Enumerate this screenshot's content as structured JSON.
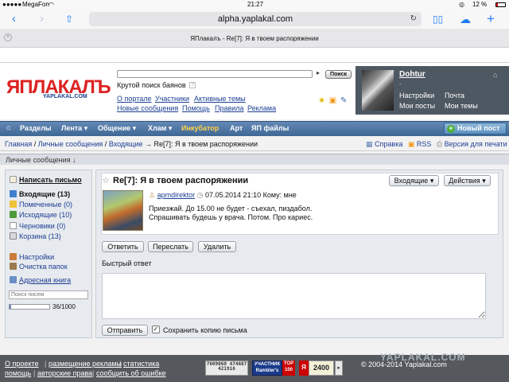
{
  "status": {
    "carrier": "MegaFon",
    "time": "21:27",
    "battery": "12 %"
  },
  "browser": {
    "url": "alpha.yaplakal.com",
    "tab_title": "ЯПлакалъ - Re[7]: Я в твоем распоряжении"
  },
  "header": {
    "logo_main": "ЯПЛАКАЛЪ",
    "logo_sub": "YAPLAKAL.COM",
    "search_placeholder": "",
    "search_button": "Поиск",
    "tagline": "Крутой поиск баянов",
    "links_row1": [
      "О портале",
      "Участники",
      "Активные темы"
    ],
    "links_row2": [
      "Новые сообщения",
      "Помощь",
      "Правила",
      "Реклама"
    ]
  },
  "user": {
    "name": "Dohtur",
    "dash": "-",
    "links": [
      "Настройки",
      "Почта",
      "Мои посты",
      "Мои темы"
    ]
  },
  "nav": {
    "items": [
      "Разделы",
      "Лента",
      "Общение",
      "Хлам",
      "Инкубатор",
      "Арт",
      "ЯП файлы"
    ],
    "new_post": "Новый пост",
    "highlight_color": "#ffd24a"
  },
  "breadcrumb": {
    "items": [
      "Главная",
      "Личные сообщения",
      "Входящие"
    ],
    "current": "Re[7]: Я в твоем распоряжении",
    "right": [
      "Справка",
      "RSS",
      "Версия для печати"
    ]
  },
  "section_title": "Личные сообщения ↓",
  "sidebar": {
    "write": "Написать письмо",
    "folders": [
      {
        "label": "Входящие (13)",
        "bold": true
      },
      {
        "label": "Помеченные (0)",
        "bold": false
      },
      {
        "label": "Исходящие (10)",
        "bold": false
      },
      {
        "label": "Черновики (0)",
        "bold": false
      },
      {
        "label": "Корзина (13)",
        "bold": false
      }
    ],
    "settings": "Настройки",
    "clean": "Очистка папок",
    "address": "Адресная книга",
    "search_placeholder": "Поиск писем",
    "quota": "36/1000",
    "quota_fraction": 0.036
  },
  "message": {
    "title": "Re[7]: Я в твоем распоряжении",
    "folder_dropdown": "Входящие",
    "actions_dropdown": "Действия",
    "author": "apmdirektor",
    "date": "07.05.2014 21:10",
    "to": "Кому: мне",
    "body_line1": "Приезжай. До 15.00 не будет - съехал, пиздабол.",
    "body_line2": "Спрашивать будешь у врача. Потом. Про кариес.",
    "buttons": [
      "Ответить",
      "Переслать",
      "Удалить"
    ]
  },
  "quick_reply": {
    "label": "Быстрый ответ",
    "send": "Отправить",
    "save_copy": "Сохранить копию письма"
  },
  "footer": {
    "row1": [
      "О проекте",
      "размещение рекламы",
      "статистика"
    ],
    "row2": [
      "помощь",
      "авторские права",
      "сообщить об ошибке"
    ],
    "counter1": "7609060 474687 421916",
    "counter2": "УЧАСТНИК Rambler's",
    "counter2_top": "TOP 100",
    "counter3": "2400",
    "copyright": "© 2004-2014 Yaplakal.com",
    "watermark": "YAPLAKAL.COM"
  }
}
